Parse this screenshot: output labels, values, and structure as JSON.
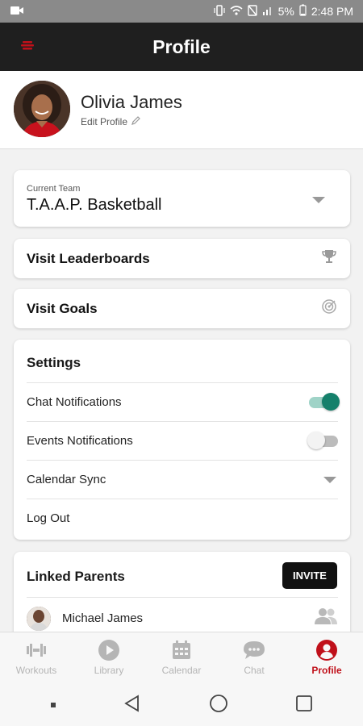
{
  "status_bar": {
    "battery": "5%",
    "time": "2:48 PM"
  },
  "header": {
    "title": "Profile"
  },
  "profile": {
    "name": "Olivia James",
    "edit_label": "Edit Profile"
  },
  "team": {
    "label": "Current Team",
    "value": "T.A.A.P. Basketball"
  },
  "leaderboards": {
    "label": "Visit Leaderboards"
  },
  "goals": {
    "label": "Visit Goals"
  },
  "settings": {
    "title": "Settings",
    "chat_notifications": {
      "label": "Chat Notifications",
      "enabled": true
    },
    "events_notifications": {
      "label": "Events Notifications",
      "enabled": false
    },
    "calendar_sync": {
      "label": "Calendar Sync"
    },
    "logout": {
      "label": "Log Out"
    }
  },
  "linked_parents": {
    "title": "Linked Parents",
    "invite_label": "INVITE",
    "parents": [
      {
        "name": "Michael James"
      }
    ]
  },
  "tabs": [
    {
      "label": "Workouts",
      "icon": "dumbbell-icon",
      "active": false
    },
    {
      "label": "Library",
      "icon": "play-icon",
      "active": false
    },
    {
      "label": "Calendar",
      "icon": "calendar-icon",
      "active": false
    },
    {
      "label": "Chat",
      "icon": "chat-icon",
      "active": false
    },
    {
      "label": "Profile",
      "icon": "user-icon",
      "active": true
    }
  ],
  "colors": {
    "accent": "#c0101a",
    "toggle_on": "#15806b",
    "header_bg": "#1f1f1f"
  }
}
